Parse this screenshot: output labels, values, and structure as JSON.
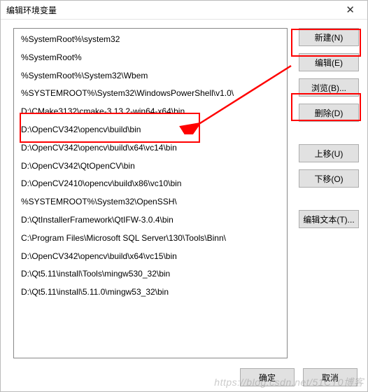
{
  "window": {
    "title": "编辑环境变量",
    "close_glyph": "✕"
  },
  "list": {
    "items": [
      "%SystemRoot%\\system32",
      "%SystemRoot%",
      "%SystemRoot%\\System32\\Wbem",
      "%SYSTEMROOT%\\System32\\WindowsPowerShell\\v1.0\\",
      "D:\\CMake3132\\cmake-3.13.2-win64-x64\\bin",
      "D:\\OpenCV342\\opencv\\build\\bin",
      "D:\\OpenCV342\\opencv\\build\\x64\\vc14\\bin",
      "D:\\OpenCV342\\QtOpenCV\\bin",
      "D:\\OpenCV2410\\opencv\\build\\x86\\vc10\\bin",
      "%SYSTEMROOT%\\System32\\OpenSSH\\",
      "D:\\QtInstallerFramework\\QtIFW-3.0.4\\bin",
      "C:\\Program Files\\Microsoft SQL Server\\130\\Tools\\Binn\\",
      "D:\\OpenCV342\\opencv\\build\\x64\\vc15\\bin",
      "D:\\Qt5.11\\install\\Tools\\mingw530_32\\bin",
      "D:\\Qt5.11\\install\\5.11.0\\mingw53_32\\bin"
    ]
  },
  "buttons": {
    "new": "新建(N)",
    "edit": "编辑(E)",
    "browse": "浏览(B)...",
    "delete": "删除(D)",
    "moveup": "上移(U)",
    "movedown": "下移(O)",
    "edittext": "编辑文本(T)...",
    "ok": "确定",
    "cancel": "取消"
  },
  "annotation": {
    "highlight_color": "#ff0000"
  },
  "watermark": "https://blog.csdn.net/51CT0博客"
}
